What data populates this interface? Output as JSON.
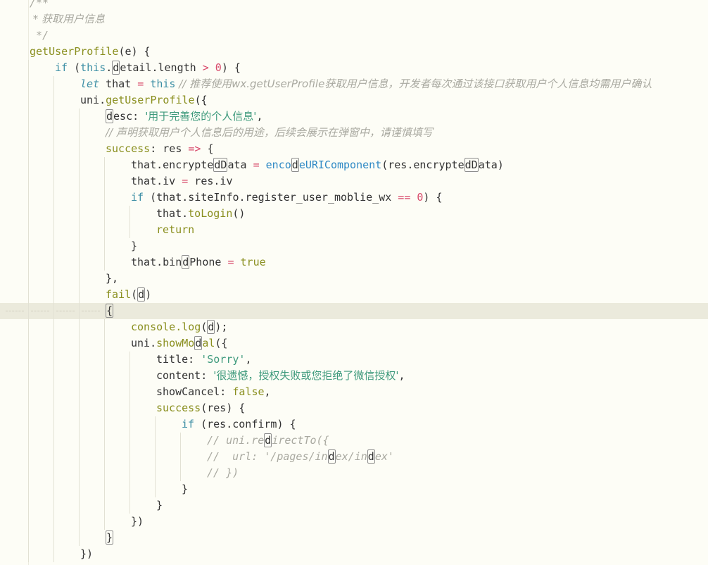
{
  "editor": {
    "lines": [
      {
        "indent": 1,
        "tokens": [
          {
            "t": "/**",
            "k": "comment"
          }
        ]
      },
      {
        "indent": 1,
        "tokens": [
          {
            "t": " * 获取用户信息",
            "k": "comment"
          }
        ]
      },
      {
        "indent": 1,
        "tokens": [
          {
            "t": " */",
            "k": "comment"
          }
        ]
      },
      {
        "indent": 1,
        "tokens": [
          {
            "t": "getUserProfile",
            "k": "method"
          },
          {
            "t": "(e) {",
            "k": "plain"
          }
        ]
      },
      {
        "indent": 2,
        "tokens": [
          {
            "t": "if",
            "k": "keyword"
          },
          {
            "t": " (",
            "k": "plain"
          },
          {
            "t": "this",
            "k": "keyword"
          },
          {
            "t": ".",
            "k": "plain"
          },
          {
            "t": "d",
            "k": "bracket"
          },
          {
            "t": "etail.length ",
            "k": "plain"
          },
          {
            "t": ">",
            "k": "operator"
          },
          {
            "t": " ",
            "k": "plain"
          },
          {
            "t": "0",
            "k": "number"
          },
          {
            "t": ") {",
            "k": "plain"
          }
        ]
      },
      {
        "indent": 3,
        "tokens": [
          {
            "t": "let",
            "k": "keyword-italic"
          },
          {
            "t": " that ",
            "k": "plain"
          },
          {
            "t": "=",
            "k": "operator"
          },
          {
            "t": " ",
            "k": "plain"
          },
          {
            "t": "this",
            "k": "keyword"
          },
          {
            "t": " // 推荐使用wx.getUserProfile获取用户信息，开发者每次通过该接口获取用户个人信息均需用户确认",
            "k": "comment"
          }
        ]
      },
      {
        "indent": 3,
        "tokens": [
          {
            "t": "uni.",
            "k": "plain"
          },
          {
            "t": "getUserProfile",
            "k": "method"
          },
          {
            "t": "({",
            "k": "plain"
          }
        ]
      },
      {
        "indent": 4,
        "tokens": [
          {
            "t": "d",
            "k": "bracket"
          },
          {
            "t": "esc: ",
            "k": "plain"
          },
          {
            "t": "'用于完善您的个人信息'",
            "k": "string"
          },
          {
            "t": ",",
            "k": "plain"
          }
        ]
      },
      {
        "indent": 4,
        "tokens": [
          {
            "t": "// 声明获取用户个人信息后的用途，后续会展示在弹窗中，请谨慎填写",
            "k": "comment"
          }
        ]
      },
      {
        "indent": 4,
        "tokens": [
          {
            "t": "success",
            "k": "method"
          },
          {
            "t": ": res ",
            "k": "plain"
          },
          {
            "t": "=>",
            "k": "operator"
          },
          {
            "t": " {",
            "k": "plain"
          }
        ]
      },
      {
        "indent": 5,
        "tokens": [
          {
            "t": "that.encrypte",
            "k": "plain"
          },
          {
            "t": "dD",
            "k": "bracket"
          },
          {
            "t": "ata ",
            "k": "plain"
          },
          {
            "t": "=",
            "k": "operator"
          },
          {
            "t": " ",
            "k": "plain"
          },
          {
            "t": "enco",
            "k": "builtin"
          },
          {
            "t": "d",
            "k": "bracket"
          },
          {
            "t": "eURIComponent",
            "k": "builtin"
          },
          {
            "t": "(res.encrypte",
            "k": "plain"
          },
          {
            "t": "dD",
            "k": "bracket"
          },
          {
            "t": "ata)",
            "k": "plain"
          }
        ]
      },
      {
        "indent": 5,
        "tokens": [
          {
            "t": "that.iv ",
            "k": "plain"
          },
          {
            "t": "=",
            "k": "operator"
          },
          {
            "t": " res.iv",
            "k": "plain"
          }
        ]
      },
      {
        "indent": 5,
        "tokens": [
          {
            "t": "if",
            "k": "keyword"
          },
          {
            "t": " (that.siteInfo.register_user_moblie_wx ",
            "k": "plain"
          },
          {
            "t": "==",
            "k": "operator"
          },
          {
            "t": " ",
            "k": "plain"
          },
          {
            "t": "0",
            "k": "number"
          },
          {
            "t": ") {",
            "k": "plain"
          }
        ]
      },
      {
        "indent": 6,
        "tokens": [
          {
            "t": "that.",
            "k": "plain"
          },
          {
            "t": "toLogin",
            "k": "method"
          },
          {
            "t": "()",
            "k": "plain"
          }
        ]
      },
      {
        "indent": 6,
        "tokens": [
          {
            "t": "return",
            "k": "method"
          }
        ]
      },
      {
        "indent": 5,
        "tokens": [
          {
            "t": "}",
            "k": "plain"
          }
        ]
      },
      {
        "indent": 5,
        "tokens": [
          {
            "t": "that.bin",
            "k": "plain"
          },
          {
            "t": "d",
            "k": "bracket"
          },
          {
            "t": "Phone ",
            "k": "plain"
          },
          {
            "t": "=",
            "k": "operator"
          },
          {
            "t": " ",
            "k": "plain"
          },
          {
            "t": "true",
            "k": "method"
          }
        ]
      },
      {
        "indent": 4,
        "tokens": [
          {
            "t": "},",
            "k": "plain"
          }
        ]
      },
      {
        "indent": 4,
        "tokens": [
          {
            "t": "fail",
            "k": "method"
          },
          {
            "t": "(",
            "k": "plain"
          },
          {
            "t": "d",
            "k": "bracket"
          },
          {
            "t": ")",
            "k": "plain"
          }
        ]
      },
      {
        "indent": 4,
        "active": true,
        "tokens": [
          {
            "t": "{",
            "k": "bracket"
          }
        ]
      },
      {
        "indent": 5,
        "tokens": [
          {
            "t": "console.",
            "k": "method"
          },
          {
            "t": "log",
            "k": "method"
          },
          {
            "t": "(",
            "k": "plain"
          },
          {
            "t": "d",
            "k": "bracket"
          },
          {
            "t": ");",
            "k": "plain"
          }
        ]
      },
      {
        "indent": 5,
        "tokens": [
          {
            "t": "uni.",
            "k": "plain"
          },
          {
            "t": "showMo",
            "k": "method"
          },
          {
            "t": "d",
            "k": "bracket"
          },
          {
            "t": "al",
            "k": "method"
          },
          {
            "t": "({",
            "k": "plain"
          }
        ]
      },
      {
        "indent": 6,
        "tokens": [
          {
            "t": "title: ",
            "k": "plain"
          },
          {
            "t": "'Sorry'",
            "k": "string"
          },
          {
            "t": ",",
            "k": "plain"
          }
        ]
      },
      {
        "indent": 6,
        "tokens": [
          {
            "t": "content: ",
            "k": "plain"
          },
          {
            "t": "'很遗憾，授权失败或您拒绝了微信授权'",
            "k": "string"
          },
          {
            "t": ",",
            "k": "plain"
          }
        ]
      },
      {
        "indent": 6,
        "tokens": [
          {
            "t": "showCancel: ",
            "k": "plain"
          },
          {
            "t": "false",
            "k": "method"
          },
          {
            "t": ",",
            "k": "plain"
          }
        ]
      },
      {
        "indent": 6,
        "tokens": [
          {
            "t": "success",
            "k": "method"
          },
          {
            "t": "(res) {",
            "k": "plain"
          }
        ]
      },
      {
        "indent": 7,
        "tokens": [
          {
            "t": "if",
            "k": "keyword"
          },
          {
            "t": " (res.confirm) {",
            "k": "plain"
          }
        ]
      },
      {
        "indent": 8,
        "tokens": [
          {
            "t": "// uni.re",
            "k": "comment"
          },
          {
            "t": "d",
            "k": "bracket"
          },
          {
            "t": "irectTo({",
            "k": "comment"
          }
        ]
      },
      {
        "indent": 8,
        "tokens": [
          {
            "t": "//  url: '/pages/in",
            "k": "comment"
          },
          {
            "t": "d",
            "k": "bracket"
          },
          {
            "t": "ex/in",
            "k": "comment"
          },
          {
            "t": "d",
            "k": "bracket"
          },
          {
            "t": "ex'",
            "k": "comment"
          }
        ]
      },
      {
        "indent": 8,
        "tokens": [
          {
            "t": "// })",
            "k": "comment"
          }
        ]
      },
      {
        "indent": 7,
        "tokens": [
          {
            "t": "}",
            "k": "plain"
          }
        ]
      },
      {
        "indent": 6,
        "tokens": [
          {
            "t": "}",
            "k": "plain"
          }
        ]
      },
      {
        "indent": 5,
        "tokens": [
          {
            "t": "})",
            "k": "plain"
          }
        ]
      },
      {
        "indent": 4,
        "tokens": [
          {
            "t": "}",
            "k": "bracket"
          }
        ]
      },
      {
        "indent": 3,
        "tokens": [
          {
            "t": "})",
            "k": "plain"
          }
        ]
      }
    ]
  }
}
